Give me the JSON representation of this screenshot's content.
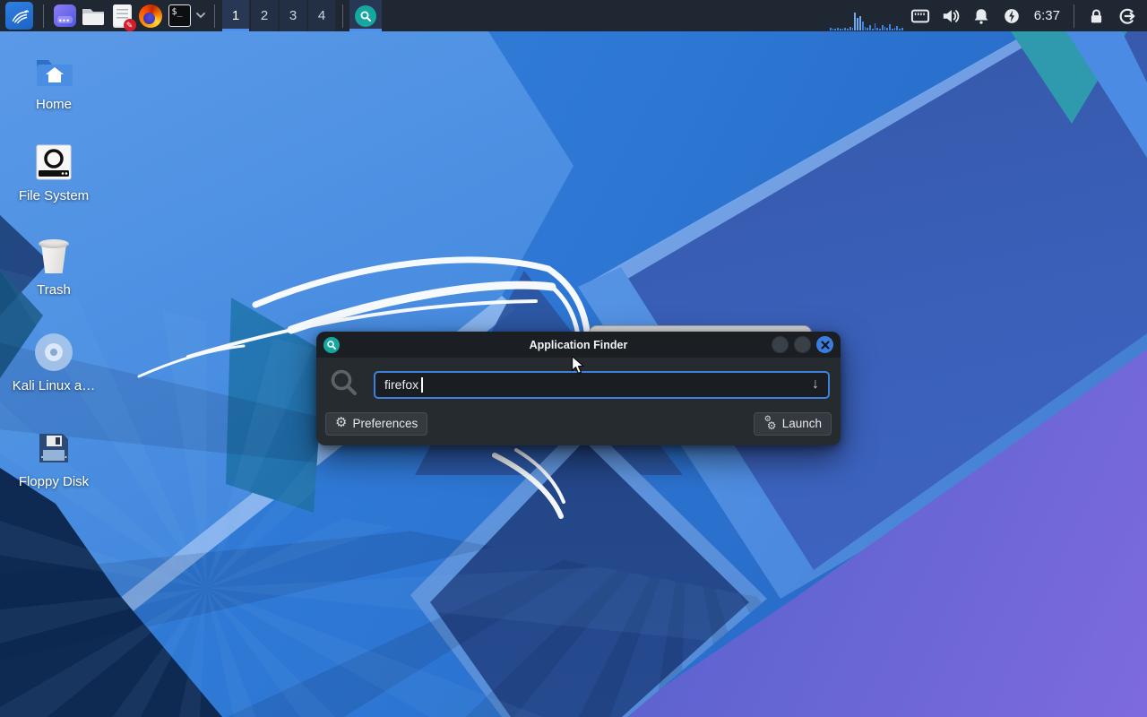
{
  "colors": {
    "accent": "#4f8fe8",
    "panel_bg": "#1f2733",
    "dialog_bg": "#262b30",
    "titlebar_bg": "#1b1f24",
    "input_border": "#3f80db",
    "close_btn": "#3a7de0",
    "finder_badge": "#16a7a0"
  },
  "panel": {
    "icons": [
      "kali-menu-icon",
      "window-manager-icon",
      "file-manager-icon",
      "text-editor-icon",
      "firefox-icon",
      "terminal-icon",
      "chevron-down-icon",
      "appfinder-icon",
      "cpu-graph",
      "display-icon",
      "volume-icon",
      "notifications-bell-icon",
      "power-manager-icon",
      "lock-icon",
      "logout-icon"
    ],
    "terminal_glyph": "$_",
    "workspaces": {
      "labels": [
        "1",
        "2",
        "3",
        "4"
      ],
      "active": "1"
    },
    "clock": "6:37",
    "cpu_bars": [
      0.15,
      0.1,
      0.1,
      0.15,
      0.1,
      0.12,
      0.15,
      0.1,
      0.2,
      0.15,
      1.0,
      0.7,
      0.82,
      0.5,
      0.2,
      0.15,
      0.32,
      0.1,
      0.42,
      0.15,
      0.1,
      0.3,
      0.2,
      0.15,
      0.36,
      0.1,
      0.15,
      0.26,
      0.1,
      0.15
    ]
  },
  "desktop": {
    "icons": [
      {
        "label": "Home"
      },
      {
        "label": "File System"
      },
      {
        "label": "Trash"
      },
      {
        "label": "Kali Linux a…"
      },
      {
        "label": "Floppy Disk"
      }
    ]
  },
  "dialog": {
    "title": "Application Finder",
    "search_value": "firefox",
    "dropdown_arrow": "↓",
    "preferences_label": "Preferences",
    "launch_label": "Launch"
  }
}
